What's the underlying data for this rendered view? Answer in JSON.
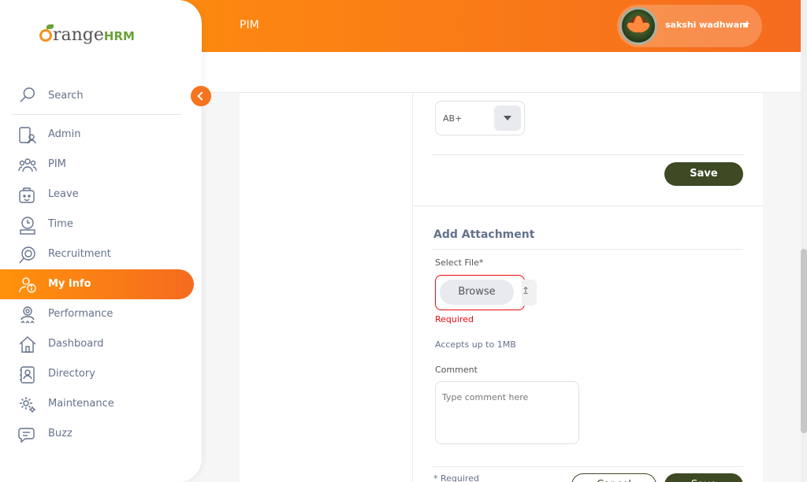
{
  "header": {
    "module_title": "PIM",
    "user_name": "sakshi wadhwani",
    "brand_gradient": [
      "#ff920b",
      "#f56b1f"
    ]
  },
  "sidebar": {
    "logo_text": "range",
    "logo_suffix": "HRM",
    "search_label": "Search",
    "items": [
      {
        "label": "Admin",
        "icon": "admin-icon"
      },
      {
        "label": "PIM",
        "icon": "pim-icon"
      },
      {
        "label": "Leave",
        "icon": "leave-icon"
      },
      {
        "label": "Time",
        "icon": "time-icon"
      },
      {
        "label": "Recruitment",
        "icon": "recruitment-icon"
      },
      {
        "label": "My Info",
        "icon": "my-info-icon",
        "active": true
      },
      {
        "label": "Performance",
        "icon": "performance-icon"
      },
      {
        "label": "Dashboard",
        "icon": "dashboard-icon"
      },
      {
        "label": "Directory",
        "icon": "directory-icon"
      },
      {
        "label": "Maintenance",
        "icon": "maintenance-icon"
      },
      {
        "label": "Buzz",
        "icon": "buzz-icon"
      }
    ]
  },
  "custom_fields": {
    "blood_type_value": "AB+",
    "save_label": "Save"
  },
  "attachment": {
    "title": "Add Attachment",
    "file_label": "Select File*",
    "browse_label": "Browse",
    "error": "Required",
    "hint": "Accepts up to 1MB",
    "comment_label": "Comment",
    "comment_placeholder": "Type comment here",
    "required_note": "* Required",
    "cancel_label": "Cancel",
    "save_label": "Save"
  },
  "colors": {
    "accent": "#ff7b1d",
    "button_dark": "#3d4a23",
    "error": "#eb0910"
  }
}
